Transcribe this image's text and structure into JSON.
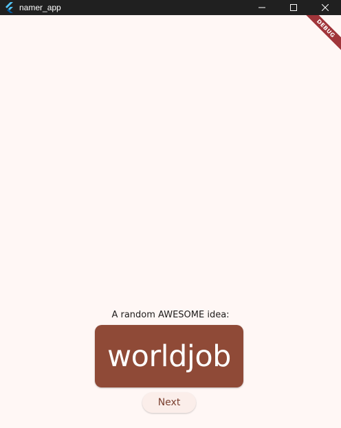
{
  "window": {
    "title": "namer_app",
    "icon": "flutter-logo-icon",
    "controls": [
      "minimize-icon",
      "maximize-icon",
      "close-icon"
    ]
  },
  "debug_banner": {
    "label": "DEBUG",
    "color": "#a0353a"
  },
  "main": {
    "intro_text": "A random AWESOME idea:",
    "word_pair": "worldjob",
    "next_label": "Next"
  },
  "colors": {
    "background": "#fff7f5",
    "card": "#8f4a37",
    "button_text": "#7a3f2f",
    "titlebar": "#202020"
  }
}
